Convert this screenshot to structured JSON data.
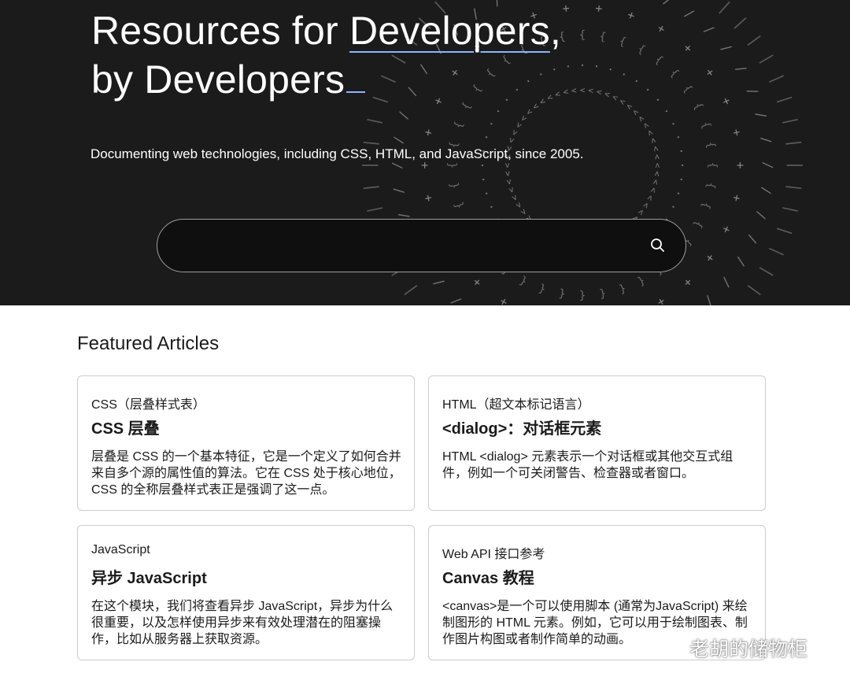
{
  "hero": {
    "title_pre": "Resources for ",
    "title_link": "Developers",
    "title_comma": ",",
    "title_line2": "by Developers",
    "subtitle": "Documenting web technologies, including CSS, HTML, and JavaScript, since 2005."
  },
  "search": {
    "value": "",
    "placeholder": "",
    "button_icon": "search-icon"
  },
  "featured": {
    "heading": "Featured Articles",
    "cards": [
      {
        "category": "CSS（层叠样式表）",
        "title": "CSS 层叠",
        "description": "层叠是 CSS 的一个基本特征，它是一个定义了如何合并来自多个源的属性值的算法。它在 CSS 处于核心地位，CSS 的全称层叠样式表正是强调了这一点。"
      },
      {
        "category": "HTML（超文本标记语言）",
        "title": "<dialog>：对话框元素",
        "description": "HTML <dialog> 元素表示一个对话框或其他交互式组件，例如一个可关闭警告、检查器或者窗口。"
      },
      {
        "category": "JavaScript",
        "title": "异步 JavaScript",
        "description": "在这个模块，我们将查看异步 JavaScript，异步为什么很重要，以及怎样使用异步来有效处理潜在的阻塞操作，比如从服务器上获取资源。"
      },
      {
        "category": "Web API 接口参考",
        "title": "Canvas 教程",
        "description": "<canvas>是一个可以使用脚本 (通常为JavaScript) 来绘制图形的 HTML 元素。例如，它可以用于绘制图表、制作图片构图或者制作简单的动画。"
      }
    ]
  },
  "watermark": {
    "text": "老胡的储物柜",
    "icon": "wechat-icon"
  },
  "colors": {
    "hero_bg": "#1b1b1b",
    "accent": "#8cb4ff",
    "card_border": "#cdcdcd"
  }
}
